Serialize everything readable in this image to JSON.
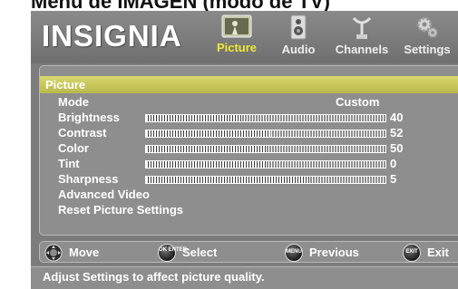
{
  "doc_heading": "Menú de IMAGEN (modo de TV)",
  "header": {
    "logo": "INSIGNIA",
    "tabs": [
      {
        "label": "Picture",
        "icon": "picture-tv-icon",
        "active": true
      },
      {
        "label": "Audio",
        "icon": "speaker-icon",
        "active": false
      },
      {
        "label": "Channels",
        "icon": "antenna-icon",
        "active": false
      },
      {
        "label": "Settings",
        "icon": "gears-icon",
        "active": false
      }
    ]
  },
  "picture_menu": {
    "title": "Picture",
    "mode": {
      "label": "Mode",
      "value": "Custom"
    },
    "sliders": [
      {
        "label": "Brightness",
        "value": "40",
        "fill": 0.4
      },
      {
        "label": "Contrast",
        "value": "52",
        "fill": 0.52
      },
      {
        "label": "Color",
        "value": "50",
        "fill": 0.5
      },
      {
        "label": "Tint",
        "value": "0",
        "fill": 0.5
      },
      {
        "label": "Sharpness",
        "value": "5",
        "fill": 0.68
      }
    ],
    "links": [
      {
        "label": "Advanced Video"
      },
      {
        "label": "Reset Picture Settings"
      }
    ]
  },
  "help": [
    {
      "label": "Move",
      "icon": "dpad-icon",
      "key": ""
    },
    {
      "label": "Select",
      "icon": "ok-enter-button-icon",
      "key": "OK ENTER"
    },
    {
      "label": "Previous",
      "icon": "menu-button-icon",
      "key": "MENU"
    },
    {
      "label": "Exit",
      "icon": "exit-button-icon",
      "key": "EXIT"
    }
  ],
  "status": "Adjust Settings to affect picture quality.",
  "colors": {
    "background": "#7c7c7c",
    "panel": "#8e8e8e",
    "title_bar": "#c9c85c",
    "active_tab": "#f0e832"
  }
}
